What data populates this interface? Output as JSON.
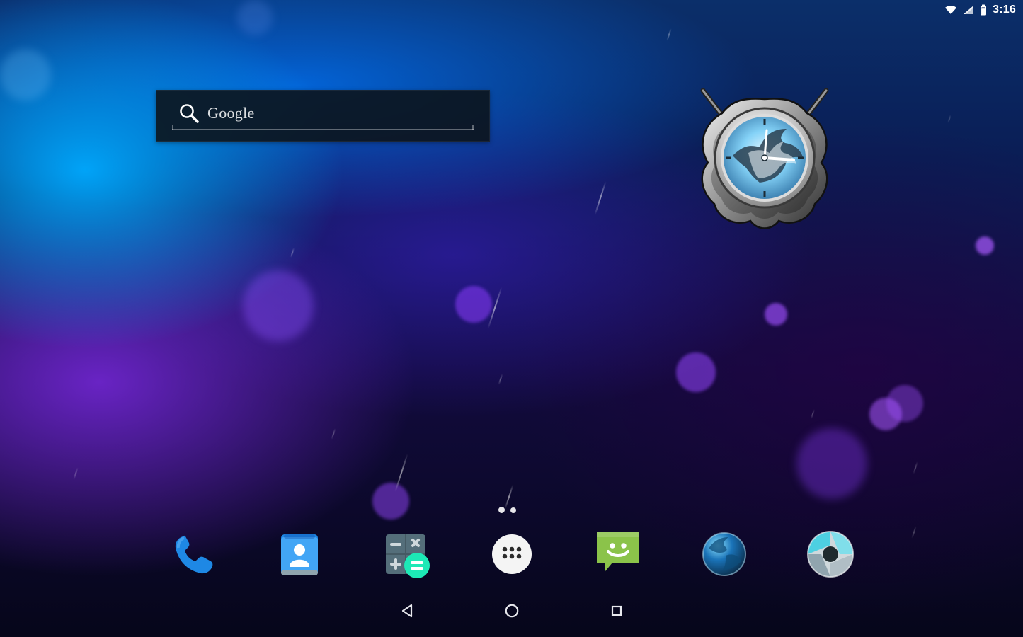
{
  "status_bar": {
    "time": "3:16",
    "icons": [
      "wifi-icon",
      "cell-signal-icon",
      "battery-icon"
    ]
  },
  "google_widget": {
    "label": "Google",
    "icon": "search-icon"
  },
  "clock_widget": {
    "icon": "wolf-crest-clock-icon"
  },
  "home_pages": {
    "count": 2,
    "active_index": 0
  },
  "dock": {
    "apps": [
      {
        "name": "phone",
        "icon": "phone-icon"
      },
      {
        "name": "contacts",
        "icon": "contacts-icon"
      },
      {
        "name": "calculator",
        "icon": "calculator-icon"
      },
      {
        "name": "all-apps",
        "icon": "all-apps-icon"
      },
      {
        "name": "messaging",
        "icon": "message-icon"
      },
      {
        "name": "browser",
        "icon": "globe-icon"
      },
      {
        "name": "camera",
        "icon": "camera-aperture-icon"
      }
    ]
  },
  "navigation_bar": {
    "buttons": [
      "back-icon",
      "home-icon",
      "recents-icon"
    ]
  },
  "colors": {
    "wallpaper_blue": "#0b2f6a",
    "wallpaper_purple": "#120b3e",
    "widget_bg": "#0c141c",
    "accent_blue": "#1e88e5",
    "accent_green": "#8bc34a",
    "accent_teal": "#1de9b6"
  }
}
